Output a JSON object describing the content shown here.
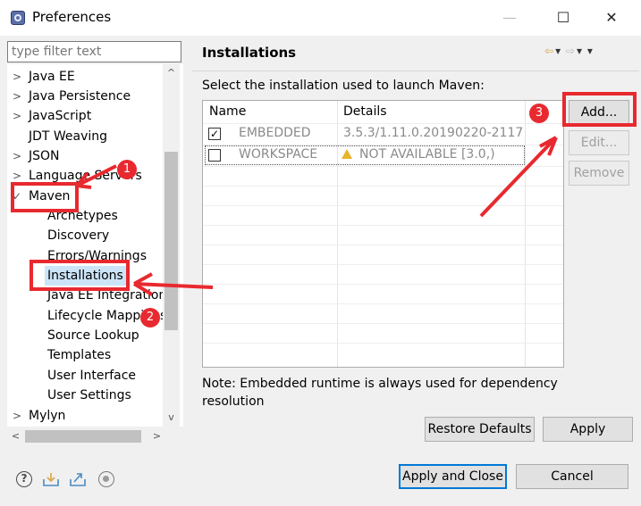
{
  "window": {
    "title": "Preferences",
    "minimize": "—",
    "maximize": "☐",
    "close": "✕"
  },
  "filter": {
    "placeholder": "type filter text"
  },
  "tree": {
    "items": [
      {
        "label": "Java EE",
        "chevron": ">"
      },
      {
        "label": "Java Persistence",
        "chevron": ">"
      },
      {
        "label": "JavaScript",
        "chevron": ">"
      },
      {
        "label": "JDT Weaving",
        "chevron": ""
      },
      {
        "label": "JSON",
        "chevron": ">"
      },
      {
        "label": "Language Servers",
        "chevron": ">"
      },
      {
        "label": "Maven",
        "chevron": "✓"
      },
      {
        "label": "Archetypes",
        "chevron": ""
      },
      {
        "label": "Discovery",
        "chevron": ""
      },
      {
        "label": "Errors/Warnings",
        "chevron": ""
      },
      {
        "label": "Installations",
        "chevron": "",
        "selected": true
      },
      {
        "label": "Java EE Integration",
        "chevron": ""
      },
      {
        "label": "Lifecycle Mappings",
        "chevron": ""
      },
      {
        "label": "Source Lookup",
        "chevron": ""
      },
      {
        "label": "Templates",
        "chevron": ""
      },
      {
        "label": "User Interface",
        "chevron": ""
      },
      {
        "label": "User Settings",
        "chevron": ""
      },
      {
        "label": "Mylyn",
        "chevron": ">"
      }
    ],
    "scroll_up": "^",
    "scroll_down": "v",
    "scroll_left": "<",
    "scroll_right": ">"
  },
  "panel": {
    "title": "Installations",
    "nav": {
      "back": "⇦",
      "back_menu": "▾",
      "forward": "⇨",
      "forward_menu": "▾",
      "view_menu": "▾"
    },
    "instruction": "Select the installation used to launch Maven:",
    "table": {
      "headers": [
        "Name",
        "Details"
      ],
      "rows": [
        {
          "checked": true,
          "check_mark": "✓",
          "name": "EMBEDDED",
          "details": "3.5.3/1.11.0.20190220-2117",
          "warning": false
        },
        {
          "checked": false,
          "check_mark": "",
          "name": "WORKSPACE",
          "details": "NOT AVAILABLE [3.0,)",
          "warning": true
        }
      ]
    },
    "buttons": {
      "add": "Add...",
      "edit": "Edit...",
      "remove": "Remove"
    },
    "note": "Note: Embedded runtime is always used for dependency resolution",
    "restore_defaults": "Restore Defaults",
    "apply": "Apply"
  },
  "footer": {
    "help": "?",
    "apply_close": "Apply and Close",
    "cancel": "Cancel"
  },
  "annotations": {
    "badge1": "1",
    "badge2": "2",
    "badge3": "3",
    "color": "#e8292f"
  }
}
